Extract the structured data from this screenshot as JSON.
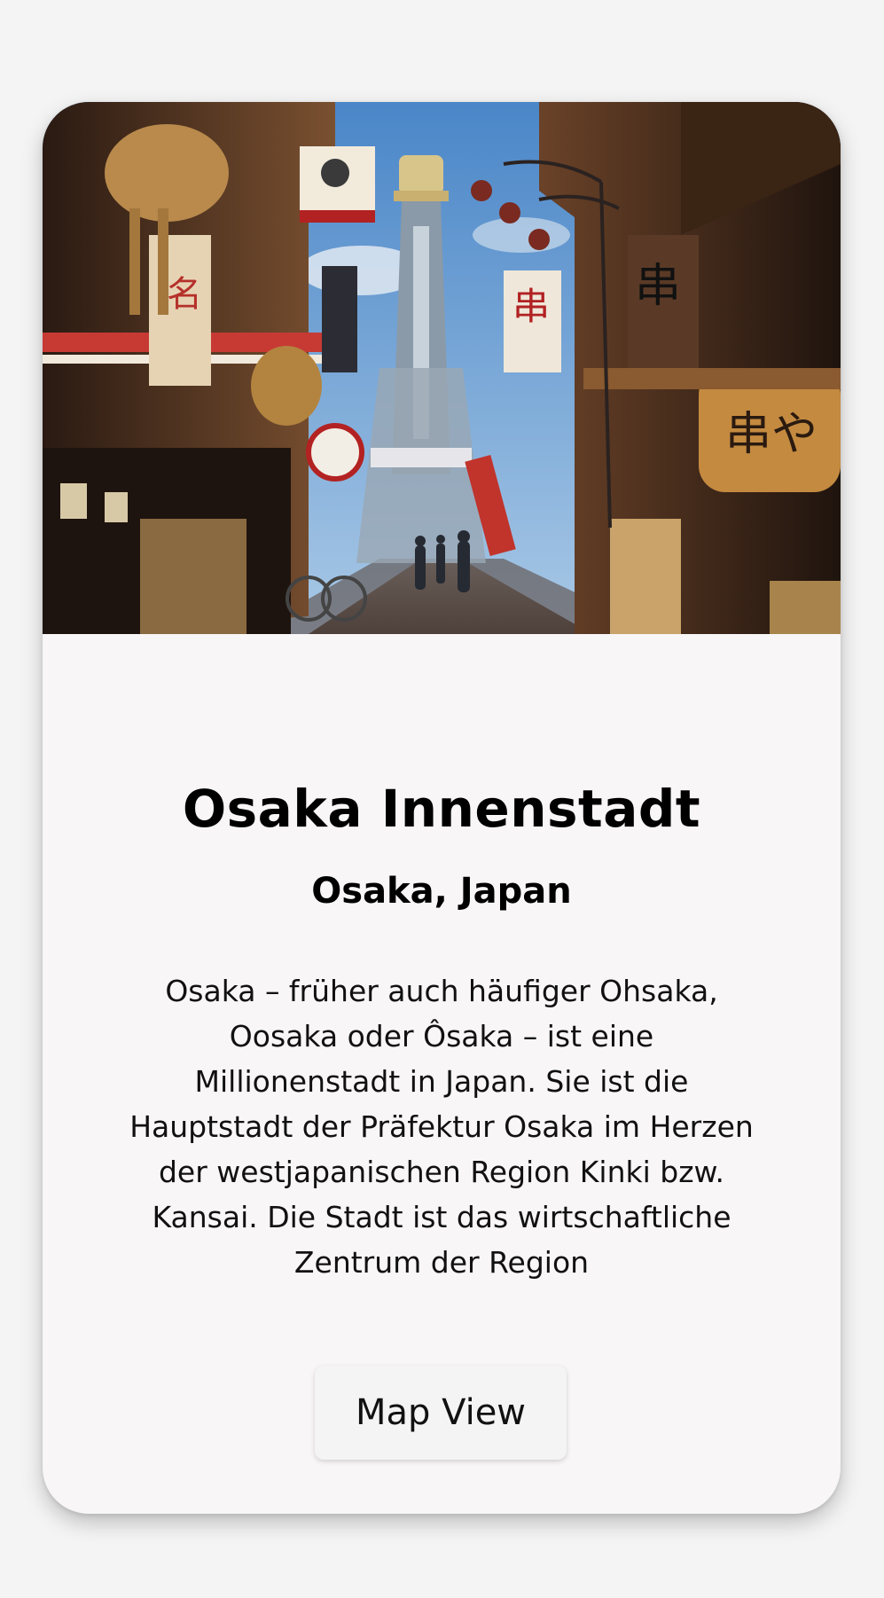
{
  "card": {
    "image_alt": "Street view of Shinsekai district with Tsutenkaku tower",
    "title": "Osaka Innenstadt",
    "subtitle": "Osaka, Japan",
    "description": "Osaka – früher auch häufiger Ohsaka, Oosaka oder Ôsaka – ist eine Millionenstadt in Japan. Sie ist die Hauptstadt der Präfektur Osaka im Herzen der westjapanischen Region Kinki bzw. Kansai. Die Stadt ist das wirtschaftliche Zentrum der Region",
    "button_label": "Map View"
  },
  "colors": {
    "background": "#f4f4f4",
    "card": "#f8f6f6",
    "text": "#000000"
  }
}
